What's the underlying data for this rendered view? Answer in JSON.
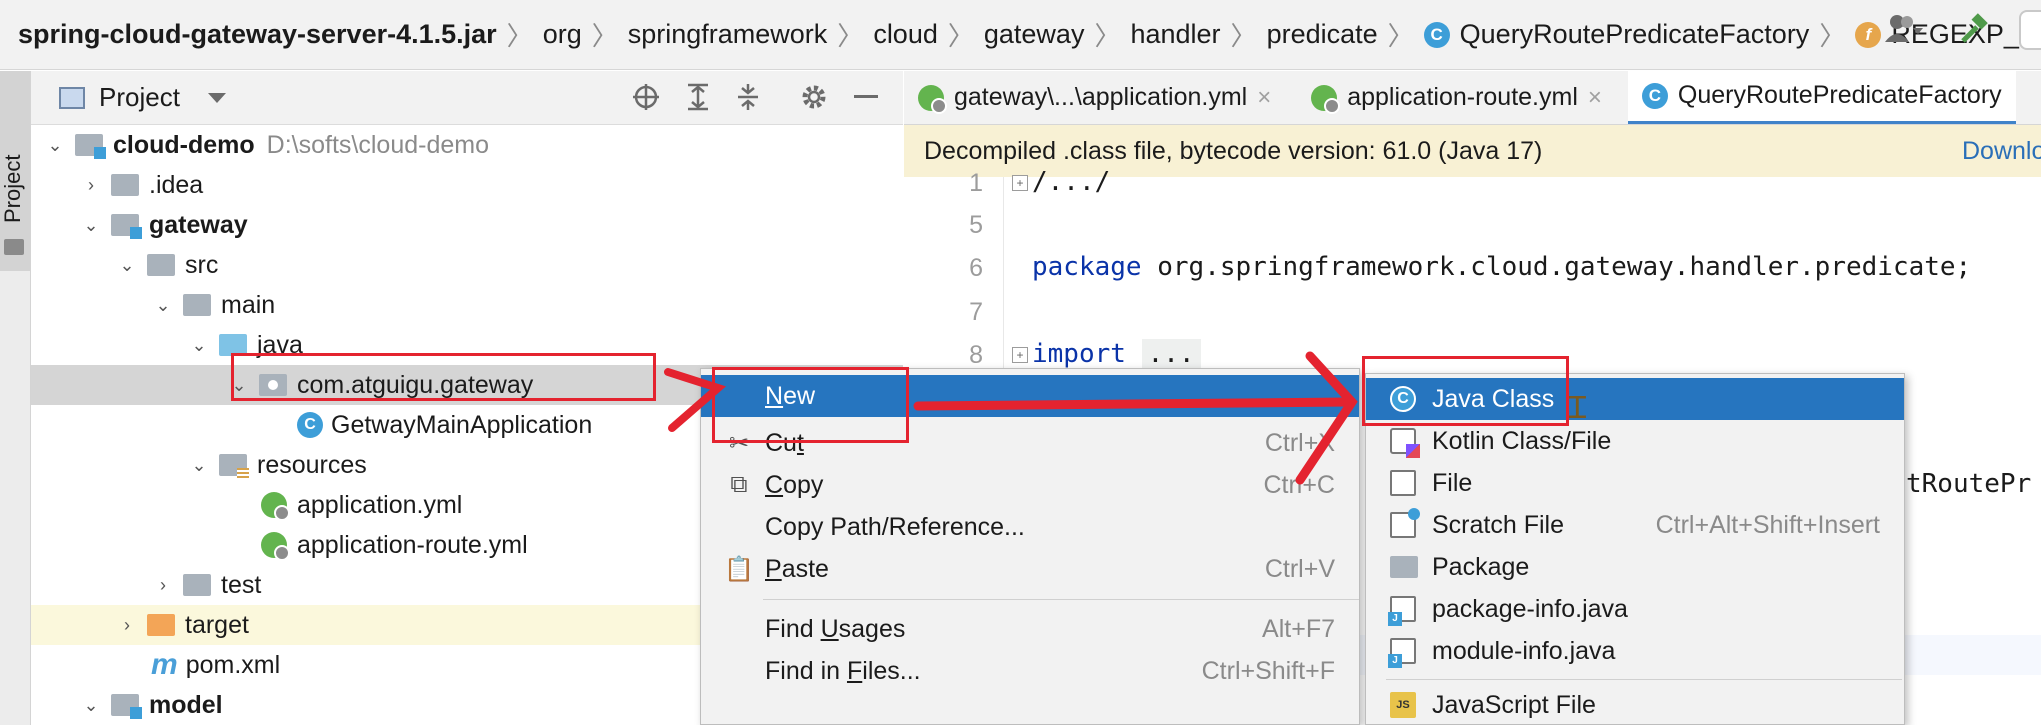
{
  "breadcrumb": {
    "items": [
      "spring-cloud-gateway-server-4.1.5.jar",
      "org",
      "springframework",
      "cloud",
      "gateway",
      "handler",
      "predicate",
      "QueryRoutePredicateFactory",
      "REGEXP_KEY"
    ],
    "class_icon_letter": "C",
    "field_icon_letter": "f"
  },
  "tool_strip": {
    "project_tab": "Project"
  },
  "project_panel": {
    "title": "Project",
    "tree": [
      {
        "label": "cloud-demo",
        "path": "D:\\softs\\cloud-demo"
      },
      {
        "label": ".idea"
      },
      {
        "label": "gateway"
      },
      {
        "label": "src"
      },
      {
        "label": "main"
      },
      {
        "label": "java"
      },
      {
        "label": "com.atguigu.gateway"
      },
      {
        "label": "GetwayMainApplication"
      },
      {
        "label": "resources"
      },
      {
        "label": "application.yml"
      },
      {
        "label": "application-route.yml"
      },
      {
        "label": "test"
      },
      {
        "label": "target"
      },
      {
        "label": "pom.xml"
      },
      {
        "label": "model"
      }
    ],
    "m_icon": "m"
  },
  "editor_tabs": [
    {
      "label": "gateway\\...\\application.yml",
      "close": "×"
    },
    {
      "label": "application-route.yml",
      "close": "×"
    },
    {
      "label": "QueryRoutePredicateFactory"
    }
  ],
  "banner": {
    "text": "Decompiled .class file, bytecode version: 61.0 (Java 17)",
    "download": "Downlo"
  },
  "editor": {
    "lines": [
      {
        "num": "1",
        "code": "/.../"
      },
      {
        "num": "5",
        "code": ""
      },
      {
        "num": "6",
        "kw": "package",
        "code": " org.springframework.cloud.gateway.handler.predicate;"
      },
      {
        "num": "7",
        "code": ""
      },
      {
        "num": "8",
        "kw": "import",
        "dots": "..."
      }
    ],
    "overflow_text": "tRoutePr"
  },
  "context_menu": {
    "new": {
      "prefix": "",
      "mnemonic": "N",
      "rest": "ew"
    },
    "cut": {
      "prefix": "Cu",
      "mnemonic": "t",
      "rest": "",
      "shortcut": "Ctrl+X"
    },
    "copy": {
      "prefix": "",
      "mnemonic": "C",
      "rest": "opy",
      "shortcut": "Ctrl+C"
    },
    "copy_path": "Copy Path/Reference...",
    "paste": {
      "prefix": "",
      "mnemonic": "P",
      "rest": "aste",
      "shortcut": "Ctrl+V"
    },
    "find_usages": {
      "prefix": "Find ",
      "mnemonic": "U",
      "rest": "sages",
      "shortcut": "Alt+F7"
    },
    "find_in_files": {
      "prefix": "Find in ",
      "mnemonic": "F",
      "rest": "iles...",
      "shortcut": "Ctrl+Shift+F"
    }
  },
  "submenu": {
    "items": [
      {
        "label": "Java Class",
        "icon": "C"
      },
      {
        "label": "Kotlin Class/File"
      },
      {
        "label": "File"
      },
      {
        "label": "Scratch File",
        "shortcut": "Ctrl+Alt+Shift+Insert"
      },
      {
        "label": "Package"
      },
      {
        "label": "package-info.java"
      },
      {
        "label": "module-info.java"
      },
      {
        "label": "JavaScript File",
        "icon": "JS"
      }
    ]
  },
  "colors": {
    "accent": "#2675bf",
    "annotation_red": "#e4232f",
    "banner_bg": "#f8f1d4",
    "keyword": "#0a33a8"
  }
}
